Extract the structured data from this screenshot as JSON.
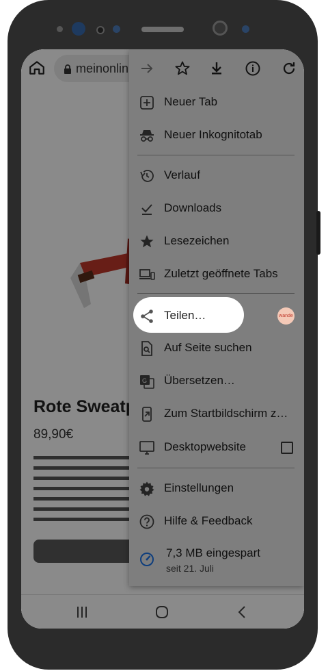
{
  "browser": {
    "url": "meinonlin",
    "toolbar_icons": [
      "home-icon",
      "lock-icon",
      "forward-icon",
      "star-icon",
      "download-icon",
      "info-icon",
      "reload-icon"
    ]
  },
  "page": {
    "product_title": "Rote Sweatp",
    "price": "89,90€"
  },
  "menu": {
    "items": [
      {
        "label": "Neuer Tab",
        "icon": "plus-box-icon"
      },
      {
        "label": "Neuer Inkognitotab",
        "icon": "incognito-icon"
      },
      {
        "label": "Verlauf",
        "icon": "history-icon"
      },
      {
        "label": "Downloads",
        "icon": "download-done-icon"
      },
      {
        "label": "Lesezeichen",
        "icon": "star-icon"
      },
      {
        "label": "Zuletzt geöffnete Tabs",
        "icon": "devices-icon"
      },
      {
        "label": "Teilen…",
        "icon": "share-icon"
      },
      {
        "label": "Auf Seite suchen",
        "icon": "find-in-page-icon"
      },
      {
        "label": "Übersetzen…",
        "icon": "translate-icon"
      },
      {
        "label": "Zum Startbildschirm z…",
        "icon": "add-to-home-icon"
      },
      {
        "label": "Desktopwebsite",
        "icon": "desktop-icon"
      },
      {
        "label": "Einstellungen",
        "icon": "settings-icon"
      },
      {
        "label": "Hilfe & Feedback",
        "icon": "help-icon"
      }
    ],
    "savings": {
      "main": "7,3 MB eingespart",
      "sub": "seit 21. Juli"
    },
    "badge_text": "wande"
  },
  "colors": {
    "sweater": "#c0392b",
    "highlight": "#ffffff",
    "accent": "#1a73e8"
  }
}
